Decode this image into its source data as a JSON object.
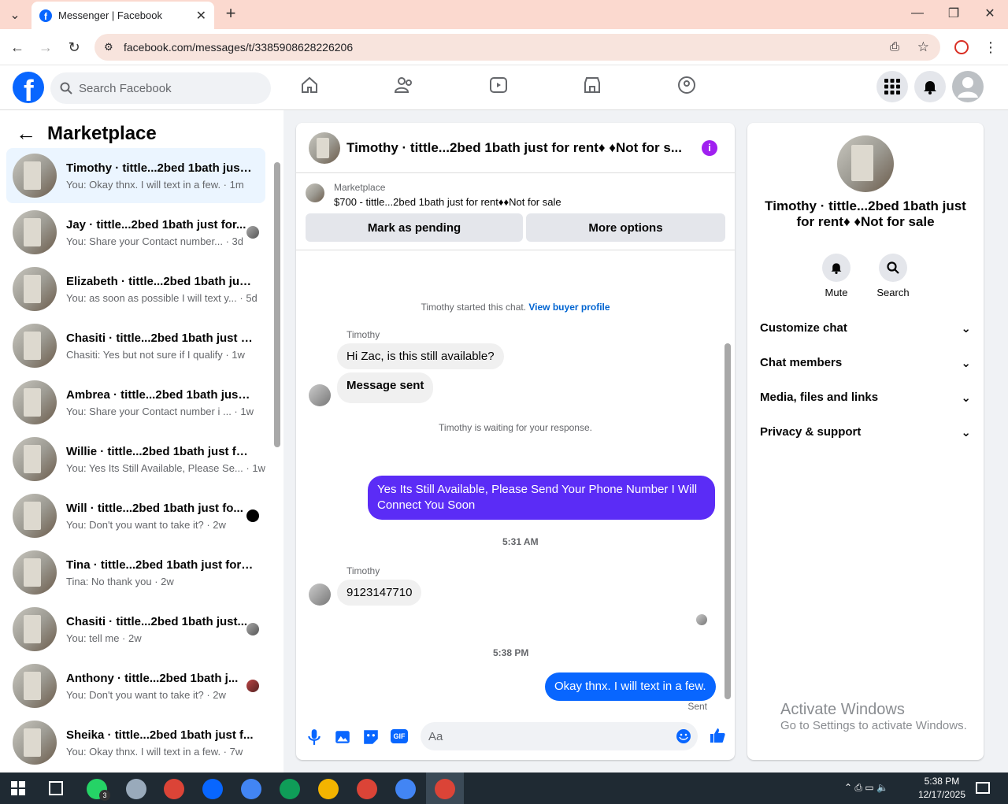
{
  "browser": {
    "tab_title": "Messenger | Facebook",
    "url": "facebook.com/messages/t/3385908628226206"
  },
  "header": {
    "search_placeholder": "Search Facebook"
  },
  "sidebar": {
    "title": "Marketplace",
    "conversations": [
      {
        "name": "Timothy · tittle...2bed 1bath just ...",
        "preview": "You: Okay thnx. I will text in a few. · 1m",
        "active": true
      },
      {
        "name": "Jay · tittle...2bed 1bath just for...",
        "preview": "You: Share your Contact number... · 3d"
      },
      {
        "name": "Elizabeth · tittle...2bed 1bath just...",
        "preview": "You: as soon as possible I will text y... · 5d"
      },
      {
        "name": "Chasiti · tittle...2bed 1bath just f...",
        "preview": "Chasiti: Yes but not sure if I qualify · 1w"
      },
      {
        "name": "Ambrea · tittle...2bed 1bath just ...",
        "preview": "You: Share your Contact number i ... · 1w"
      },
      {
        "name": "Willie · tittle...2bed 1bath just for...",
        "preview": "You: Yes Its Still Available, Please Se... · 1w"
      },
      {
        "name": "Will · tittle...2bed 1bath just fo...",
        "preview": "You: Don't you want to take it? · 2w"
      },
      {
        "name": "Tina · tittle...2bed 1bath just for ...",
        "preview": "Tina: No thank you · 2w"
      },
      {
        "name": "Chasiti · tittle...2bed 1bath just...",
        "preview": "You: tell me · 2w"
      },
      {
        "name": "Anthony · tittle...2bed 1bath j...",
        "preview": "You: Don't you want to take it? · 2w"
      },
      {
        "name": "Sheika · tittle...2bed 1bath just f...",
        "preview": "You: Okay thnx. I will text in a few. · 7w"
      }
    ]
  },
  "chat": {
    "title": "Timothy · tittle...2bed 1bath just for rent♦ ♦Not for s...",
    "listing_label": "Marketplace",
    "listing_price": "$700 - tittle...2bed 1bath just for rent♦♦Not for sale",
    "mark_pending": "Mark as pending",
    "more_options": "More options",
    "started": "Timothy started this chat.",
    "view_buyer": "View buyer profile",
    "sender": "Timothy",
    "msg1": "Hi Zac, is this still available?",
    "msg2": "Message sent",
    "waiting": "Timothy is waiting for your response.",
    "my_msg1": "Yes Its Still Available, Please Send Your Phone Number I Will Connect You Soon",
    "time1": "5:31 AM",
    "msg3": "9123147710",
    "time2": "5:38 PM",
    "my_msg2": "Okay thnx. I will text in a few.",
    "sent": "Sent",
    "input_placeholder": "Aa",
    "gif": "GIF"
  },
  "panel": {
    "name": "Timothy · tittle...2bed 1bath just for rent♦ ♦Not for sale",
    "mute": "Mute",
    "search": "Search",
    "sections": [
      "Customize chat",
      "Chat members",
      "Media, files and links",
      "Privacy & support"
    ]
  },
  "watermark": {
    "line1": "Activate Windows",
    "line2": "Go to Settings to activate Windows."
  },
  "taskbar": {
    "time": "5:38 PM",
    "date": "12/17/2025",
    "whatsapp_badge": "3"
  },
  "colors": {
    "fb_blue": "#0866ff",
    "my_bubble": "#5b2cf6",
    "tab_bar": "#fbd9cf"
  }
}
